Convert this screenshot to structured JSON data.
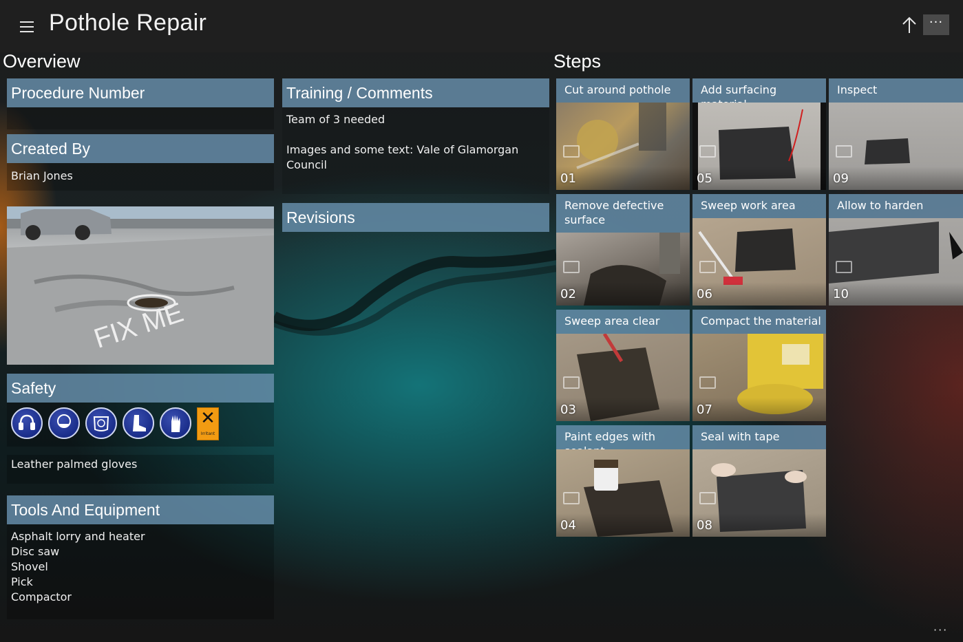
{
  "app": {
    "title": "Pothole Repair",
    "menu_icon": "hamburger-icon",
    "up_icon": "arrow-up-icon",
    "more_label": "···",
    "footer_more_label": "···"
  },
  "overview": {
    "heading": "Overview",
    "procedure_number": {
      "label": "Procedure Number",
      "value": ""
    },
    "created_by": {
      "label": "Created By",
      "value": "Brian Jones"
    },
    "photo": {
      "text": "FIX ME"
    },
    "safety": {
      "label": "Safety",
      "icons": [
        "ear-protection-icon",
        "dust-mask-icon",
        "face-shield-icon",
        "safety-boots-icon",
        "gloves-icon",
        "irritant-hazard-icon"
      ],
      "hazard_caption": "Irritant",
      "note": "Leather palmed gloves"
    },
    "tools": {
      "label": "Tools And Equipment",
      "items": [
        "Asphalt lorry and heater",
        "Disc saw",
        "Shovel",
        "Pick",
        "Compactor"
      ]
    }
  },
  "training": {
    "label": "Training / Comments",
    "lines": [
      "Team of 3 needed",
      "Images and some text: Vale of Glamorgan Council"
    ]
  },
  "revisions": {
    "label": "Revisions"
  },
  "steps": {
    "heading": "Steps",
    "items": [
      {
        "title": "Cut around pothole",
        "number": "01"
      },
      {
        "title": "Remove defective surface",
        "number": "02"
      },
      {
        "title": "Sweep area clear",
        "number": "03"
      },
      {
        "title": "Paint edges with sealant",
        "number": "04"
      },
      {
        "title": "Add surfacing material",
        "number": "05"
      },
      {
        "title": "Sweep work area",
        "number": "06"
      },
      {
        "title": "Compact the material",
        "number": "07"
      },
      {
        "title": "Seal with tape",
        "number": "08"
      },
      {
        "title": "Inspect",
        "number": "09"
      },
      {
        "title": "Allow to harden",
        "number": "10"
      }
    ]
  },
  "colors": {
    "header_bar": "#658ca8",
    "background": "#1c1c1c",
    "accent_teal": "#148287",
    "hazard_orange": "#f29b12"
  }
}
